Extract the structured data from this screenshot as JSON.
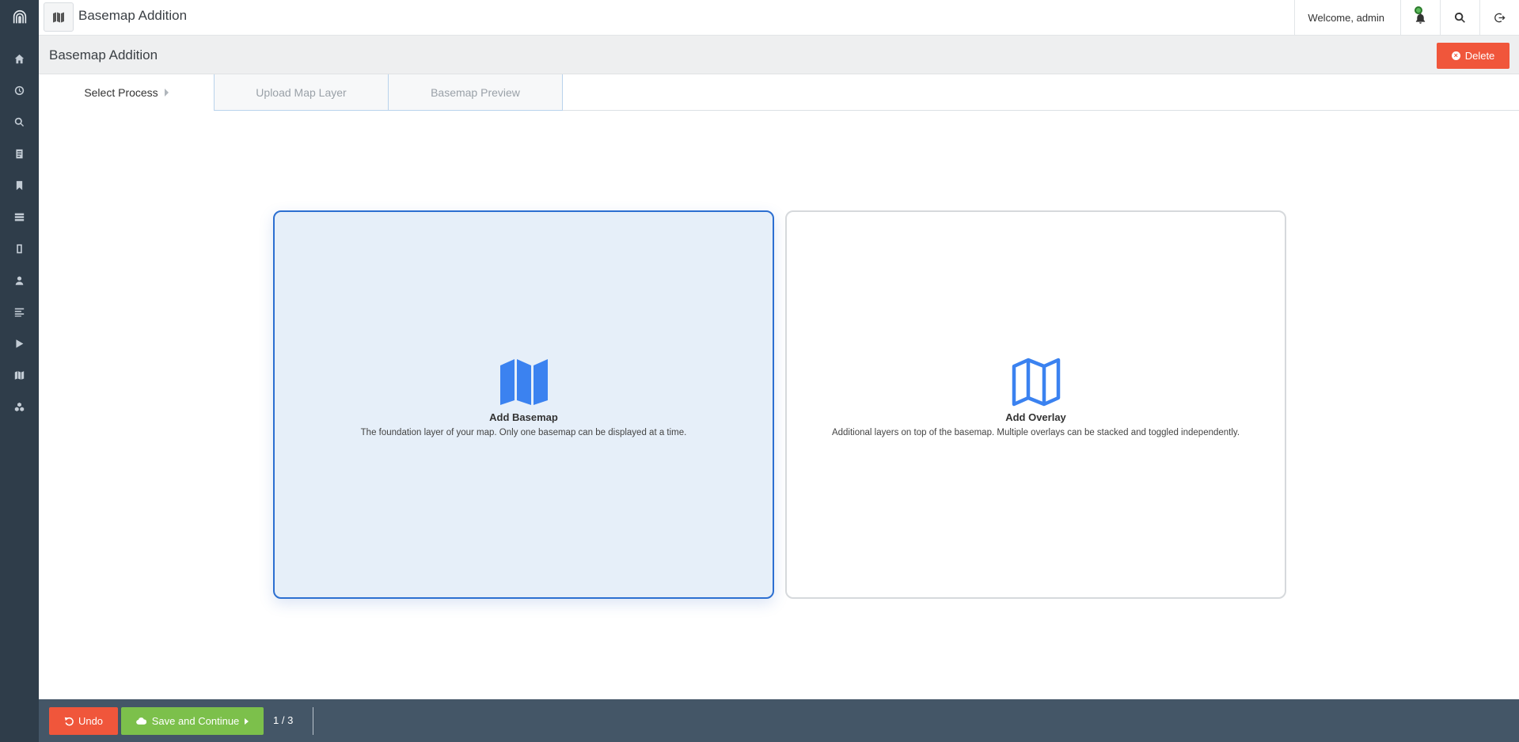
{
  "topbar": {
    "app_title": "Basemap Addition",
    "welcome_text": "Welcome, admin"
  },
  "page_header": {
    "title": "Basemap Addition",
    "delete_label": "Delete"
  },
  "steps": [
    {
      "label": "Select Process",
      "active": true
    },
    {
      "label": "Upload Map Layer",
      "active": false
    },
    {
      "label": "Basemap Preview",
      "active": false
    }
  ],
  "cards": [
    {
      "title": "Add Basemap",
      "description": "The foundation layer of your map. Only one basemap can be displayed at a time.",
      "selected": true,
      "icon": "map-filled-icon"
    },
    {
      "title": "Add Overlay",
      "description": "Additional layers on top of the basemap. Multiple overlays can be stacked and toggled independently.",
      "selected": false,
      "icon": "map-outline-icon"
    }
  ],
  "footer": {
    "undo_label": "Undo",
    "save_label": "Save and Continue",
    "page_count": "1 / 3"
  },
  "sidebar_icons": [
    "home-icon",
    "clock-icon",
    "search-icon",
    "document-icon",
    "bookmark-icon",
    "list-icon",
    "book-icon",
    "user-icon",
    "align-left-icon",
    "play-icon",
    "map-icon",
    "cubes-icon"
  ],
  "colors": {
    "sidebar_bg": "#2f3d4a",
    "accent_blue": "#2c6fd1",
    "icon_blue": "#3b82f0",
    "danger": "#f0563b",
    "success": "#7cc04b",
    "footer_bg": "#445667"
  }
}
